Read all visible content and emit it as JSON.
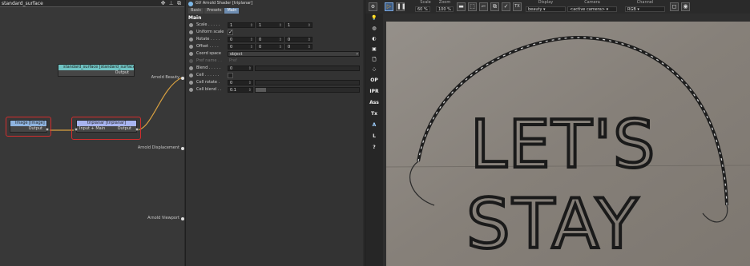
{
  "node_editor": {
    "title": "standard_surface",
    "nodes": {
      "standard_surface": {
        "title": "standard_surface [standard_surface]",
        "output": "Output"
      },
      "image": {
        "title": "image [image]",
        "output": "Output"
      },
      "triplanar": {
        "title": "triplanar [triplanar]",
        "input": "Input + Main",
        "output": "Output"
      }
    },
    "slots": {
      "beauty": "Arnold Beauty",
      "displacement": "Arnold Displacement",
      "viewport": "Arnold Viewport"
    }
  },
  "attributes": {
    "header": "GV Arnold Shader [triplanar]",
    "tabs": [
      "Basic",
      "Presets",
      "Main"
    ],
    "section": "Main",
    "scale": {
      "label": "Scale . . . . .",
      "x": "1",
      "y": "1",
      "z": "1"
    },
    "uniform_scale": {
      "label": "Uniform scale",
      "checked": true
    },
    "rotate": {
      "label": "Rotate . . . .",
      "x": "0",
      "y": "0",
      "z": "0"
    },
    "offset": {
      "label": "Offset . . . .",
      "x": "0",
      "y": "0",
      "z": "0"
    },
    "coord_space": {
      "label": "Coord space",
      "value": "object"
    },
    "pref_name": {
      "label": "Pref name . .",
      "value": "Pref"
    },
    "blend": {
      "label": "Blend . . . . .",
      "value": "0",
      "fraction": 0.0
    },
    "cell": {
      "label": "Cell . . . . . .",
      "checked": false
    },
    "cell_rotate": {
      "label": "Cell rotate .",
      "value": "0",
      "fraction": 0.0
    },
    "cell_blend": {
      "label": "Cell blend . .",
      "value": "0.1",
      "fraction": 0.1
    }
  },
  "render_view": {
    "scale_label": "Scale",
    "scale_value": "60 %",
    "zoom_label": "Zoom",
    "zoom_value": "100 %",
    "display_label": "Display",
    "display_value": "beauty",
    "camera_label": "Camera",
    "camera_value": "<active camera>",
    "channel_label": "Channel",
    "channel_value": "RGB",
    "side_buttons": [
      "OP",
      "IPR",
      "Ass",
      "Tx",
      "L",
      "?"
    ],
    "sign_line1": "LET'S",
    "sign_line2": "STAY"
  },
  "colors": {
    "selection": "#d32d2d",
    "wire": "#d8a040",
    "standard_surface_header": "#6fc3c3",
    "image_header": "#8fb4e0",
    "triplanar_header": "#a8b4f0",
    "play_button": "#3d5a80"
  }
}
